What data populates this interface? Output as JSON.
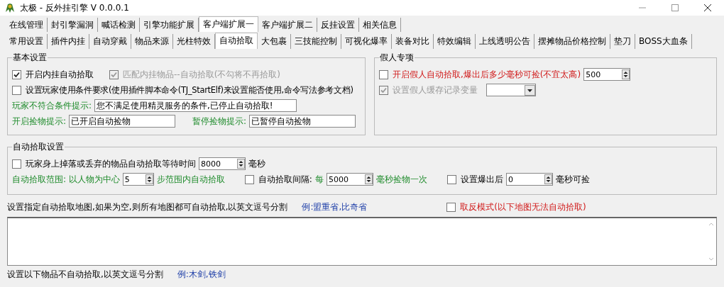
{
  "window": {
    "title": "太极 - 反外挂引擎 V 0.0.0.1"
  },
  "main_tabs": [
    {
      "label": "在线管理",
      "selected": false
    },
    {
      "label": "封引擎漏洞",
      "selected": false
    },
    {
      "label": "喊话检测",
      "selected": false
    },
    {
      "label": "引擎功能扩展",
      "selected": false
    },
    {
      "label": "客户端扩展一",
      "selected": true
    },
    {
      "label": "客户端扩展二",
      "selected": false
    },
    {
      "label": "反挂设置",
      "selected": false
    },
    {
      "label": "相关信息",
      "selected": false
    }
  ],
  "sub_tabs": [
    {
      "label": "常用设置",
      "selected": false
    },
    {
      "label": "插件内挂",
      "selected": false
    },
    {
      "label": "自动穿戴",
      "selected": false
    },
    {
      "label": "物品来源",
      "selected": false
    },
    {
      "label": "光柱特效",
      "selected": false
    },
    {
      "label": "自动拾取",
      "selected": true
    },
    {
      "label": "大包裹",
      "selected": false
    },
    {
      "label": "三技能控制",
      "selected": false
    },
    {
      "label": "可视化爆率",
      "selected": false
    },
    {
      "label": "装备对比",
      "selected": false
    },
    {
      "label": "特效编辑",
      "selected": false
    },
    {
      "label": "上线透明公告",
      "selected": false
    },
    {
      "label": "摆摊物品价格控制",
      "selected": false
    },
    {
      "label": "垫刀",
      "selected": false
    },
    {
      "label": "BOSS大血条",
      "selected": false
    }
  ],
  "basic_settings": {
    "title": "基本设置",
    "options": [
      {
        "label": "开启内挂自动拾取",
        "checked": true,
        "disabled": false
      },
      {
        "label": "匹配内挂物品--自动拾取(不勾将不再拾取)",
        "checked": true,
        "disabled": true
      }
    ],
    "condition_option": {
      "label": "设置玩家使用条件要求(使用插件脚本命令(TJ_StartElf)来设置能否使用,命令写法参考文档)",
      "checked": false
    },
    "fail_prompt": {
      "label": "玩家不符合条件提示:",
      "value": "您不满足使用精灵服务的条件,已停止自动拾取!"
    },
    "start_prompt": {
      "label": "开启捡物提示:",
      "value": "已开启自动捡物"
    },
    "pause_prompt": {
      "label": "暂停捡物提示:",
      "value": "已暂停自动捡物"
    }
  },
  "fake_player": {
    "title": "假人专项",
    "auto_pick": {
      "label": "开启假人自动拾取,爆出后多少毫秒可捡(不宜太高)",
      "checked": false,
      "value": "500"
    },
    "cache_var": {
      "label": "设置假人缓存记录变量",
      "checked": true,
      "disabled": true
    }
  },
  "auto_pick_settings": {
    "title": "自动拾取设置",
    "wait": {
      "label": "玩家身上掉落或丢弃的物品自动拾取等待时间",
      "checked": false,
      "value": "8000",
      "unit": "毫秒"
    },
    "range": {
      "label": "自动拾取范围: 以人物为中心",
      "value": "5",
      "suffix": "步范围内自动拾取"
    },
    "interval": {
      "label": "自动拾取间隔:",
      "checked": false,
      "prefix": "每",
      "value": "5000",
      "suffix": "毫秒捡物一次"
    },
    "drop_delay": {
      "label": "设置爆出后",
      "checked": false,
      "value": "0",
      "suffix": "毫秒可捡"
    }
  },
  "map_list": {
    "label": "设置指定自动拾取地图,如果为空,则所有地图都可自动拾取,以英文逗号分割",
    "example": "例:盟重省,比奇省",
    "invert": {
      "label": "取反模式(以下地图无法自动拾取)",
      "checked": false
    }
  },
  "item_list": {
    "label": "设置以下物品不自动拾取,以英文逗号分割",
    "example": "例:木剑,铁剑"
  }
}
